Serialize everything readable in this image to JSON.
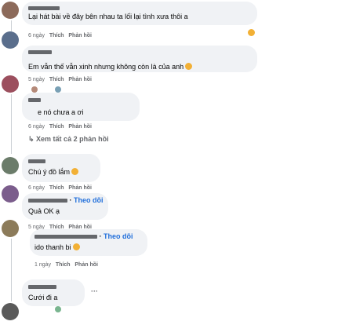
{
  "comments": [
    {
      "text": "Lại hát bài về đây bên nhau ta lối lại tình xưa thôi a",
      "time": "6 ngày",
      "like": "Thích",
      "reply": "Phản hồi"
    },
    {
      "text": "Em vẫn thế vẫn xinh nhưng không còn là của anh",
      "time": "5 ngày",
      "like": "Thích",
      "reply": "Phản hồi"
    },
    {
      "text": "e nó chưa a ơi",
      "time": "6 ngày",
      "like": "Thích",
      "reply": "Phản hồi"
    },
    {
      "text": "Chú ý đồ lắm",
      "time": "6 ngày",
      "like": "Thích",
      "reply": "Phản hồi"
    },
    {
      "text": "Quả OK ạ",
      "follow": "Theo dõi",
      "time": "5 ngày",
      "like": "Thích",
      "reply": "Phản hồi"
    },
    {
      "text": "ido thanh bi",
      "follow": "Theo dõi",
      "time": "1 ngày",
      "like": "Thích",
      "reply": "Phản hồi"
    },
    {
      "text": "Cưới đi a",
      "more": "···"
    }
  ],
  "view_replies": "Xem tất cả 2 phản hồi",
  "colors": {
    "bubble": "#f0f2f5",
    "meta": "#65676b",
    "link": "#216fdb"
  }
}
